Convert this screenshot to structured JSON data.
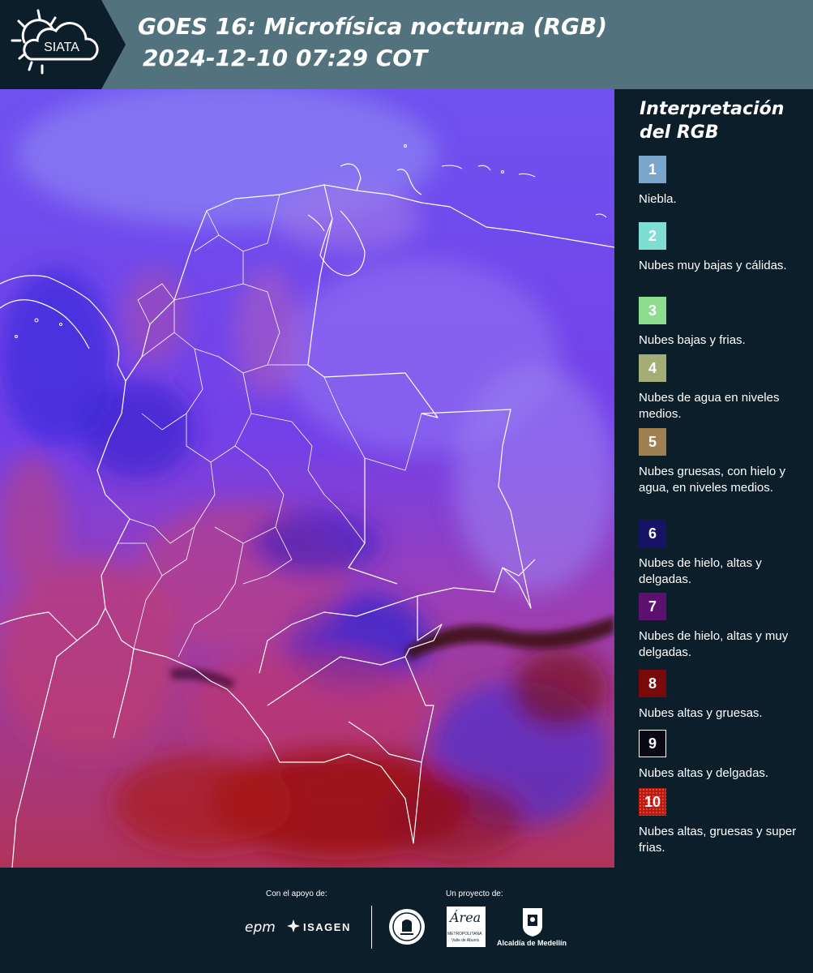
{
  "header": {
    "logo_text": "SIATA",
    "title_line1": "GOES 16: Microfísica nocturna (RGB)",
    "title_line2": "2024-12-10 07:29 COT",
    "background_color": "#52737e"
  },
  "legend": {
    "title_line1": "Interpretación",
    "title_line2": "del RGB",
    "items": [
      {
        "number": "1",
        "color": "#7aa6cb",
        "label": "Niebla."
      },
      {
        "number": "2",
        "color": "#7fded4",
        "label": "Nubes muy bajas y cálidas."
      },
      {
        "number": "3",
        "color": "#8edc8e",
        "label": "Nubes bajas y frias."
      },
      {
        "number": "4",
        "color": "#a3ad76",
        "label": "Nubes de agua en niveles medios."
      },
      {
        "number": "5",
        "color": "#9e8051",
        "label": "Nubes gruesas, con hielo y agua, en niveles medios."
      },
      {
        "number": "6",
        "color": "#161266",
        "label": "Nubes de hielo, altas y delgadas."
      },
      {
        "number": "7",
        "color": "#5c1070",
        "label": "Nubes de hielo, altas y muy delgadas."
      },
      {
        "number": "8",
        "color": "#7a0a0a",
        "label": "Nubes altas y gruesas."
      },
      {
        "number": "9",
        "color": "#090915",
        "label": "Nubes altas y delgadas."
      },
      {
        "number": "10",
        "color": "#b8190f",
        "label": "Nubes altas, gruesas y super frias."
      }
    ]
  },
  "footer": {
    "support_label": "Con el apoyo de:",
    "sponsor_1": "epm",
    "sponsor_2": "ISAGEN",
    "project_label": "Un proyecto de:",
    "partner_1_line1": "Área",
    "partner_1_line2": "METROPOLITANA",
    "partner_1_line3": "Valle de Aburrá",
    "partner_2": "Alcaldía de Medellín"
  }
}
